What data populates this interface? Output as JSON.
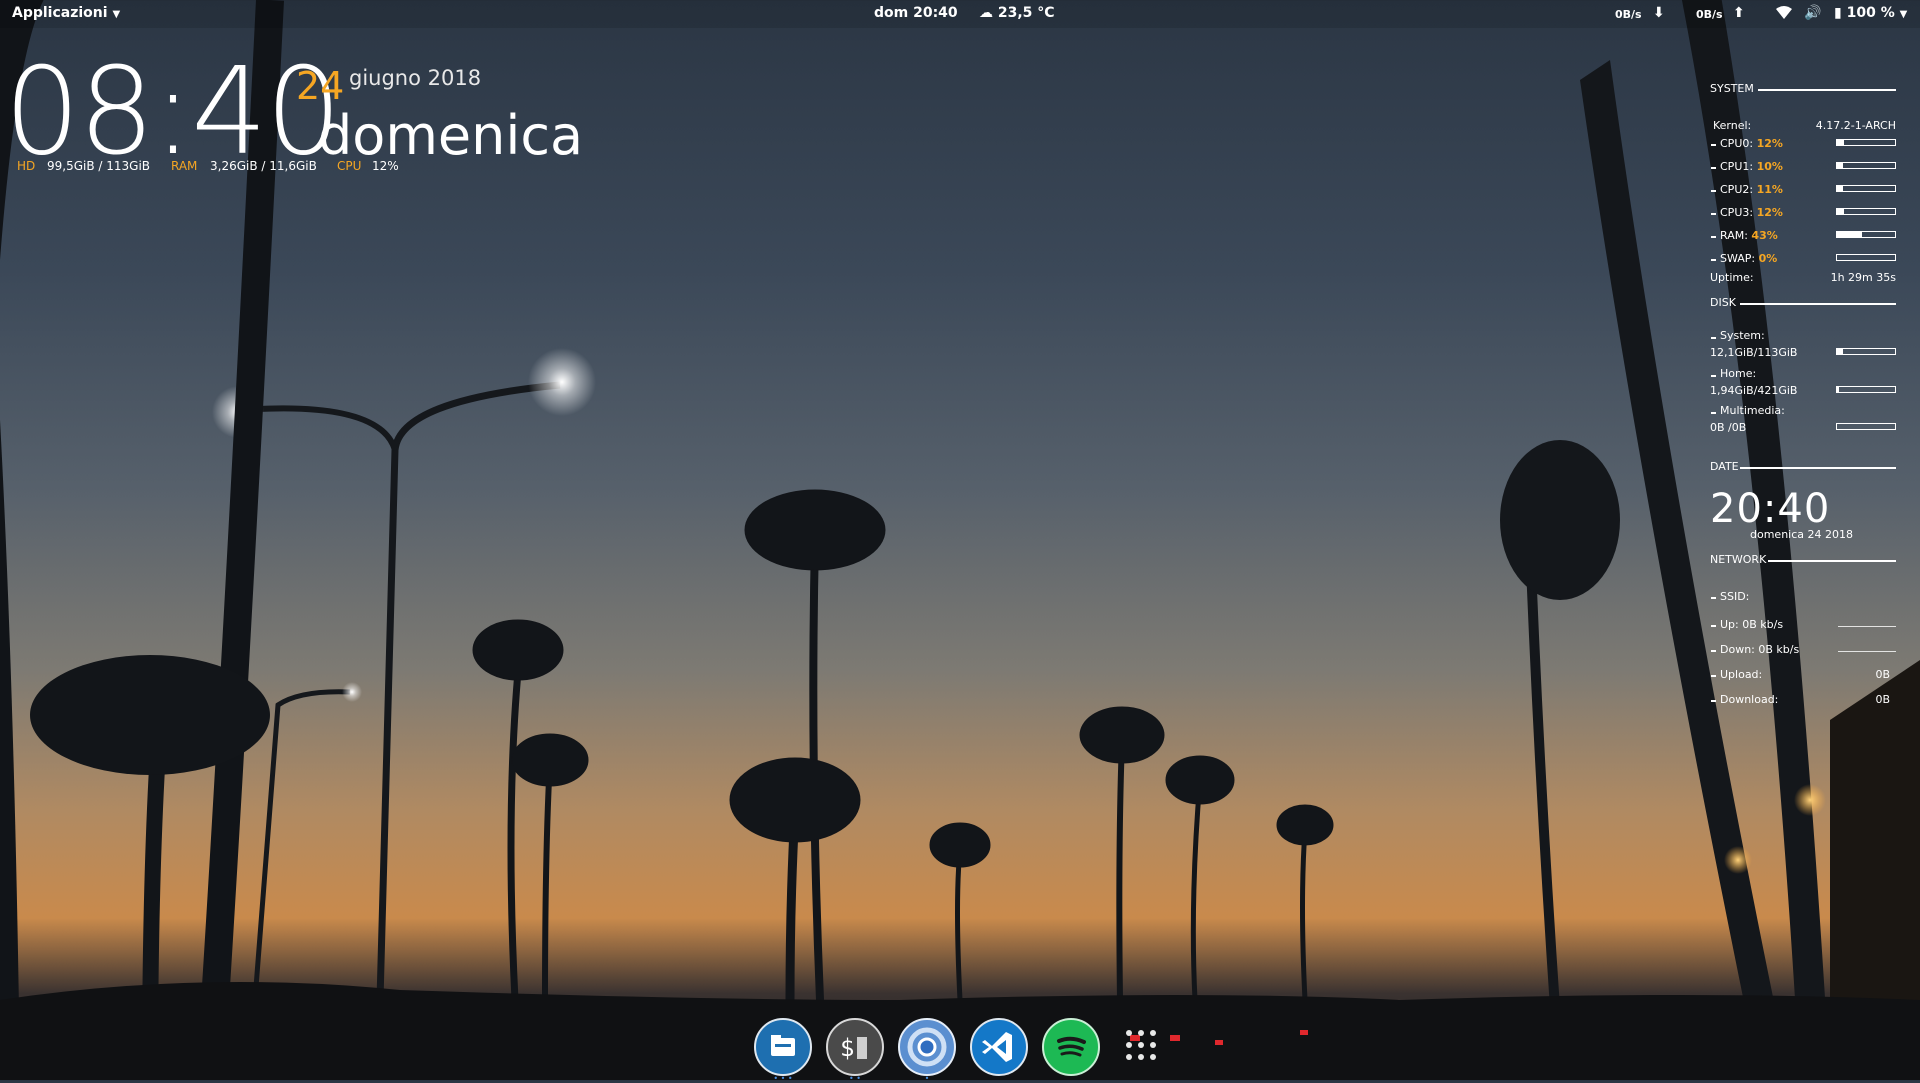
{
  "topbar": {
    "apps_menu": "Applicazioni",
    "clock": "dom 20:40",
    "weather": "23,5 °C",
    "down_rate": "0B/s",
    "up_rate": "0B/s",
    "battery": "100 %"
  },
  "desktop_clock": {
    "time": "08:40",
    "day": "24",
    "month_year": "giugno 2018",
    "weekday": "domenica",
    "hd_label": "HD",
    "hd_value": "99,5GiB / 113GiB",
    "ram_label": "RAM",
    "ram_value": "3,26GiB / 11,6GiB",
    "cpu_label": "CPU",
    "cpu_value": "12%"
  },
  "conky": {
    "system_title": "SYSTEM",
    "kernel_label": "Kernel:",
    "kernel_value": "4.17.2-1-ARCH",
    "cpu_rows": [
      {
        "label": "CPU0:",
        "value": "12%",
        "level": 0.12
      },
      {
        "label": "CPU1:",
        "value": "10%",
        "level": 0.1
      },
      {
        "label": "CPU2:",
        "value": "11%",
        "level": 0.11
      },
      {
        "label": "CPU3:",
        "value": "12%",
        "level": 0.12
      },
      {
        "label": "RAM:",
        "value": "43%",
        "level": 0.43
      },
      {
        "label": "SWAP:",
        "value": "0%",
        "level": 0.0
      }
    ],
    "uptime_label": "Uptime:",
    "uptime_value": "1h 29m 35s",
    "disk_title": "DISK",
    "disks": [
      {
        "name": "System:",
        "usage": "12,1GiB/113GiB",
        "level": 0.11
      },
      {
        "name": "Home:",
        "usage": "1,94GiB/421GiB",
        "level": 0.005
      },
      {
        "name": "Multimedia:",
        "usage": "0B /0B",
        "level": 0.0
      }
    ],
    "date_title": "DATE",
    "clock": "20:40",
    "date_line": "domenica 24 2018",
    "network_title": "NETWORK",
    "ssid_label": "SSID:",
    "up_label": "Up: 0B  kb/s",
    "down_label": "Down: 0B  kb/s",
    "upload_label": "Upload:",
    "upload_value": "0B",
    "download_label": "Download:",
    "download_value": "0B"
  },
  "dock": {
    "items": [
      "files-icon",
      "terminal-icon",
      "chromium-icon",
      "vscode-icon",
      "spotify-icon",
      "app-grid-icon"
    ]
  }
}
